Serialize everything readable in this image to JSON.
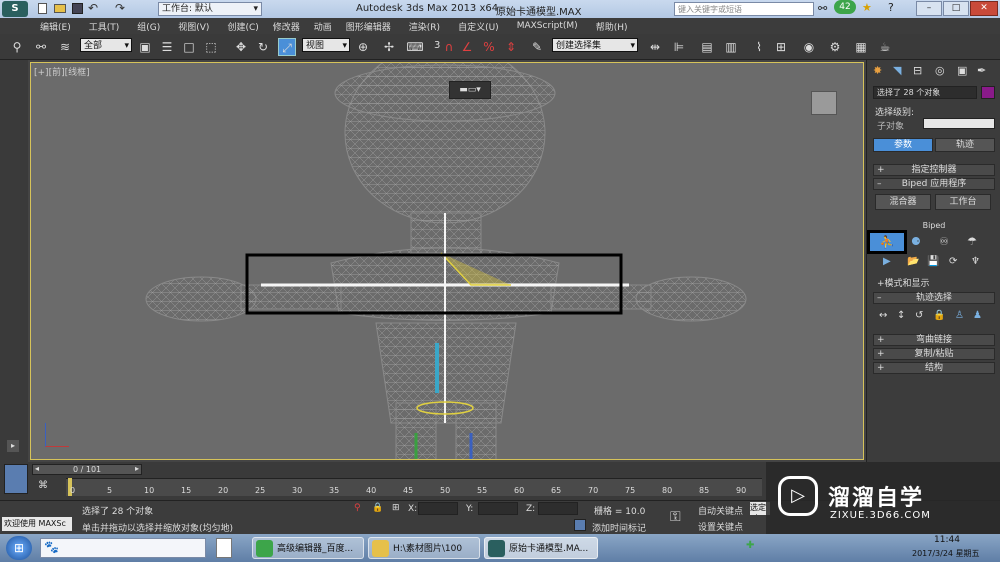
{
  "titlebar": {
    "workspace_label": "工作台: 默认",
    "app_title": "Autodesk 3ds Max  2013 x64",
    "file_name": "原始卡通模型.MAX",
    "search_placeholder": "键入关键字或短语",
    "badge_count": "42"
  },
  "menu": [
    "编辑(E)",
    "工具(T)",
    "组(G)",
    "视图(V)",
    "创建(C)",
    "修改器",
    "动画",
    "图形编辑器",
    "渲染(R)",
    "自定义(U)",
    "MAXScript(M)",
    "帮助(H)"
  ],
  "toolbar": {
    "selection_filter": "全部",
    "reference_coord": "视图",
    "named_selection": "创建选择集",
    "snap_number": "3"
  },
  "viewport": {
    "label": "[+][前][线框]"
  },
  "command_panel": {
    "selection_text": "选择了 28 个对象",
    "selection_level_label": "选择级别:",
    "sub_object_label": "子对象",
    "tab_params": "参数",
    "tab_track": "轨迹",
    "rollouts": {
      "assign_controller": "指定控制器",
      "biped_app": "Biped 应用程序",
      "mixer": "混合器",
      "workbench": "工作台",
      "biped": "Biped",
      "mode_display": "+模式和显示",
      "track_selection": "轨迹选择",
      "bend_links": "弯曲链接",
      "copy_paste": "复制/粘贴",
      "structure": "结构"
    },
    "colors": {
      "accent": "#4a8fd8",
      "swatch": "#8a1a8a"
    }
  },
  "timeline": {
    "frame_display": "0 / 101",
    "ticks": [
      "0",
      "5",
      "10",
      "15",
      "20",
      "25",
      "30",
      "35",
      "40",
      "45",
      "50",
      "55",
      "60",
      "65",
      "70",
      "75",
      "80",
      "85",
      "90"
    ]
  },
  "status": {
    "welcome": "欢迎使用 MAXSc",
    "selected": "选择了 28 个对象",
    "hint": "单击并拖动以选择并缩放对象(均匀地)",
    "x_label": "X:",
    "y_label": "Y:",
    "z_label": "Z:",
    "grid": "栅格 = 10.0",
    "auto_key": "自动关键点",
    "set_key": "设置关键点",
    "add_time_tag": "添加时间标记",
    "selected_obj": "选定对"
  },
  "taskbar": {
    "tasks": [
      "高级编辑器_百度...",
      "H:\\素材图片\\100",
      "原始卡通模型.MA..."
    ],
    "time": "11:44",
    "date": "2017/3/24 星期五"
  },
  "watermark": {
    "brand": "溜溜自学",
    "url": "ZIXUE.3D66.COM"
  }
}
